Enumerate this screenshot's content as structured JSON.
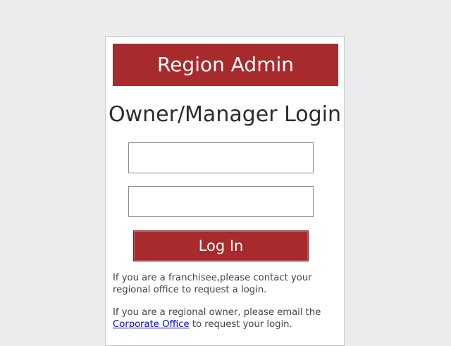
{
  "banner": {
    "title": "Region Admin"
  },
  "login": {
    "heading": "Owner/Manager Login",
    "username": {
      "value": "",
      "placeholder": ""
    },
    "password": {
      "value": "",
      "placeholder": ""
    },
    "submit_label": "Log In"
  },
  "info": {
    "franchisee_text": "If you are a franchisee,please contact your regional office to request a login.",
    "owner_text_before": "If you are a regional owner, please email the ",
    "corporate_link": "Corporate Office",
    "owner_text_after": " to request your login."
  },
  "colors": {
    "brand": "#a72a2c",
    "background": "#ebecee",
    "link": "#0000ee"
  }
}
